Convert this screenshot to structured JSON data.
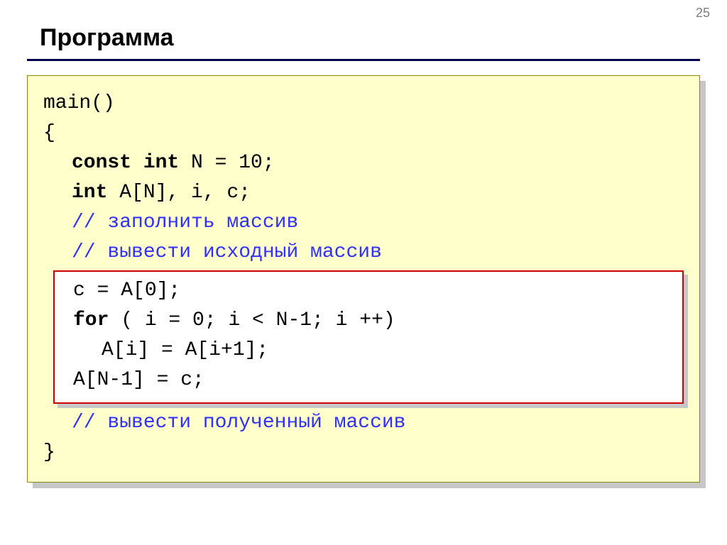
{
  "page_number": "25",
  "title": "Программа",
  "code": {
    "l1": "main()",
    "l2": "{",
    "l3a": "const int",
    "l3b": " N = 10;",
    "l4a": "int",
    "l4b": " A[N], i, c;",
    "c1": "// заполнить массив",
    "c2": "// вывести исходный массив",
    "h1": "c = A[0];",
    "h2a": "for",
    "h2b": " ( i = 0; i < N-1; i ++)",
    "h3": "A[i] = A[i+1];",
    "h4": "A[N-1] = c;",
    "c3": "// вывести полученный массив",
    "l_end": "}"
  }
}
